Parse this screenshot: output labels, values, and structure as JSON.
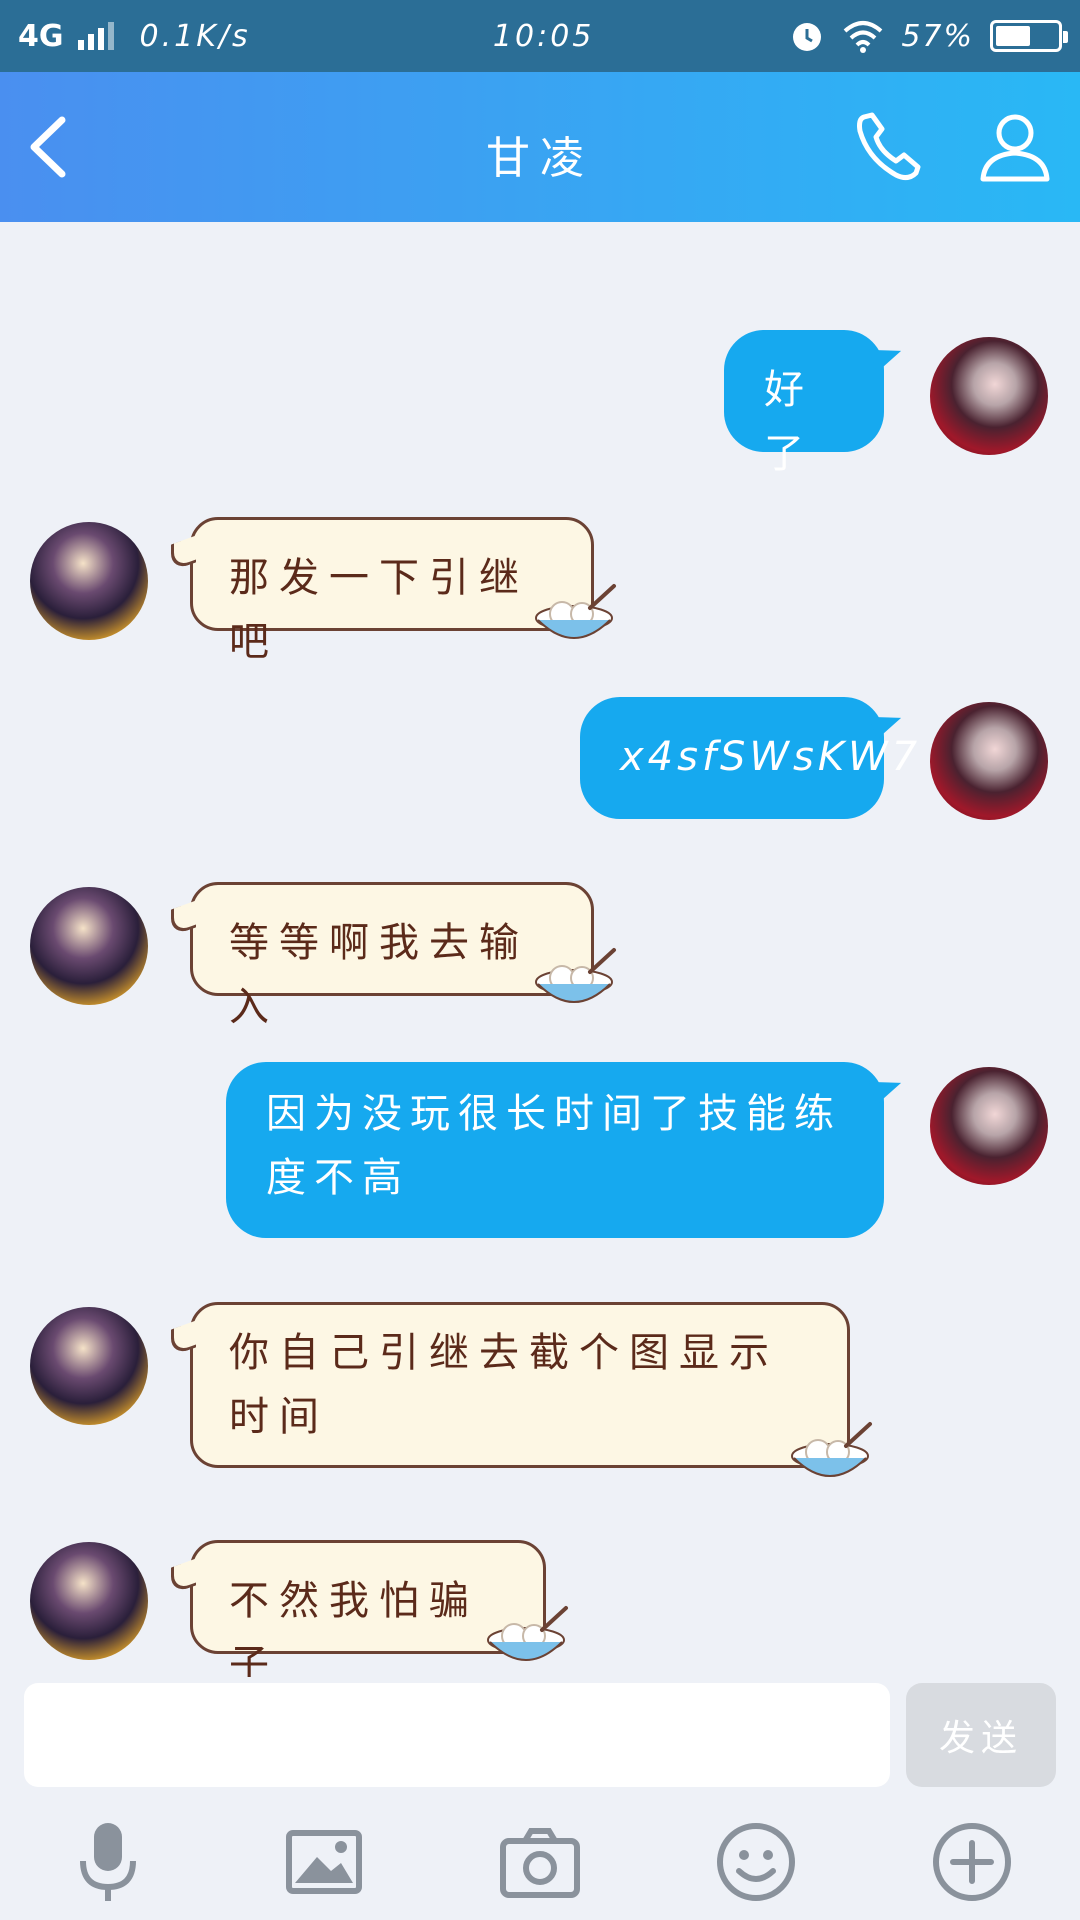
{
  "status_bar": {
    "network": "4G",
    "speed": "0.1K/s",
    "time": "10:05",
    "battery": "57%",
    "battery_level": 0.57
  },
  "header": {
    "title": "甘凌",
    "back_icon": "chevron-left-icon",
    "call_icon": "phone-icon",
    "profile_icon": "person-icon"
  },
  "messages": [
    {
      "side": "out",
      "text": "好了"
    },
    {
      "side": "in",
      "text": "那发一下引继吧"
    },
    {
      "side": "out",
      "text": "x4sfSWsKW7"
    },
    {
      "side": "in",
      "text": "等等啊我去输入"
    },
    {
      "side": "out",
      "text": "因为没玩很长时间了技能练度不高"
    },
    {
      "side": "in",
      "text": "你自己引继去截个图显示时间"
    },
    {
      "side": "in",
      "text": "不然我怕骗子"
    }
  ],
  "input": {
    "value": "",
    "placeholder": "",
    "send_label": "发送"
  },
  "toolbar": [
    "microphone-icon",
    "image-icon",
    "camera-icon",
    "emoji-icon",
    "plus-icon"
  ],
  "colors": {
    "header_start": "#4a8ff0",
    "header_end": "#29b8f5",
    "bubble_out": "#16a9ef",
    "bubble_in": "#fdf7e4",
    "background": "#eef1f7"
  }
}
